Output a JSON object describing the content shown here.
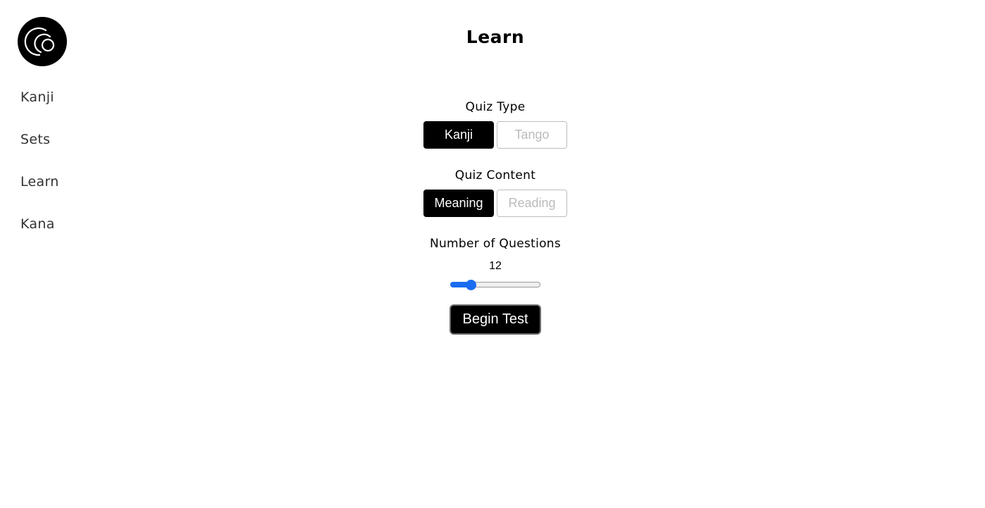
{
  "logo": {
    "icon": "spiral-logo-icon"
  },
  "sidebar": {
    "items": [
      {
        "label": "Kanji"
      },
      {
        "label": "Sets"
      },
      {
        "label": "Learn"
      },
      {
        "label": "Kana"
      }
    ]
  },
  "page": {
    "title": "Learn"
  },
  "quiz_type": {
    "label": "Quiz Type",
    "options": [
      "Kanji",
      "Tango"
    ],
    "selected": "Kanji"
  },
  "quiz_content": {
    "label": "Quiz Content",
    "options": [
      "Meaning",
      "Reading"
    ],
    "selected": "Meaning"
  },
  "questions": {
    "label": "Number of Questions",
    "value": "12",
    "slider_fraction": 0.23
  },
  "actions": {
    "begin_label": "Begin Test"
  },
  "colors": {
    "accent": "#1a6cf0",
    "active_bg": "#000000",
    "inactive_text": "#bbbbbb"
  }
}
